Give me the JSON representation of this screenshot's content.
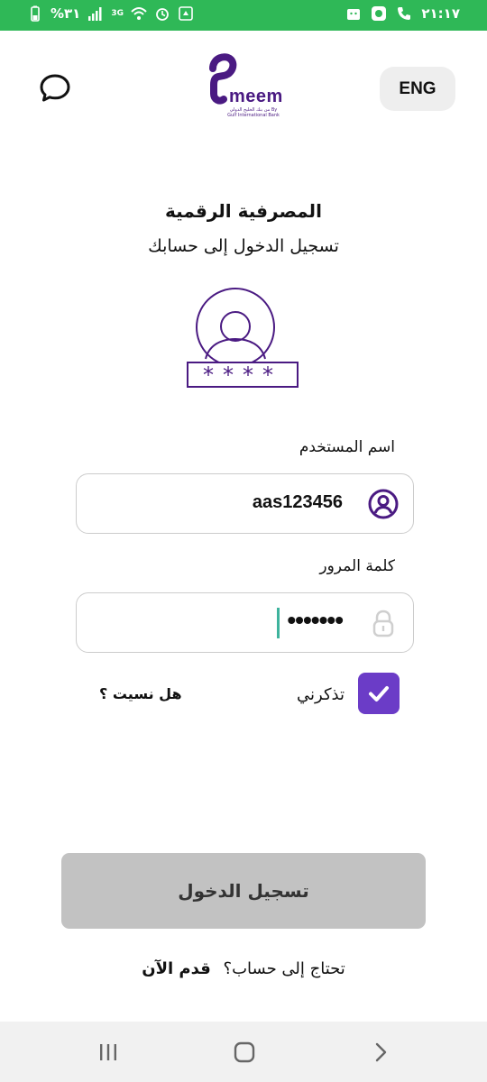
{
  "status_bar": {
    "battery": "%٣١",
    "network": "3G",
    "time": "٢١:١٧",
    "bg_color": "#2fb857"
  },
  "header": {
    "logo_text": "meem",
    "logo_subtext": "من بنك الخليج الدولي By Gulf International Bank",
    "language_button": "ENG",
    "chat_icon": "chat-bubble-icon"
  },
  "title": "المصرفية الرقمية",
  "subtitle": "تسجيل الدخول إلى حسابك",
  "hero_pin": "****",
  "form": {
    "username_label": "اسم المستخدم",
    "username_value": "aas123456",
    "password_label": "كلمة المرور",
    "password_value": "•••••••",
    "remember_label": "تذكرني",
    "remember_checked": true,
    "forgot_label": "هل نسيت ؟"
  },
  "login_button": "تسجيل الدخول",
  "signup": {
    "question": "تحتاج إلى حساب؟",
    "link": "قدم الآن"
  },
  "colors": {
    "brand_purple": "#4a1a82",
    "checkbox_purple": "#6b3cc7",
    "button_disabled": "#c2c2c2"
  }
}
